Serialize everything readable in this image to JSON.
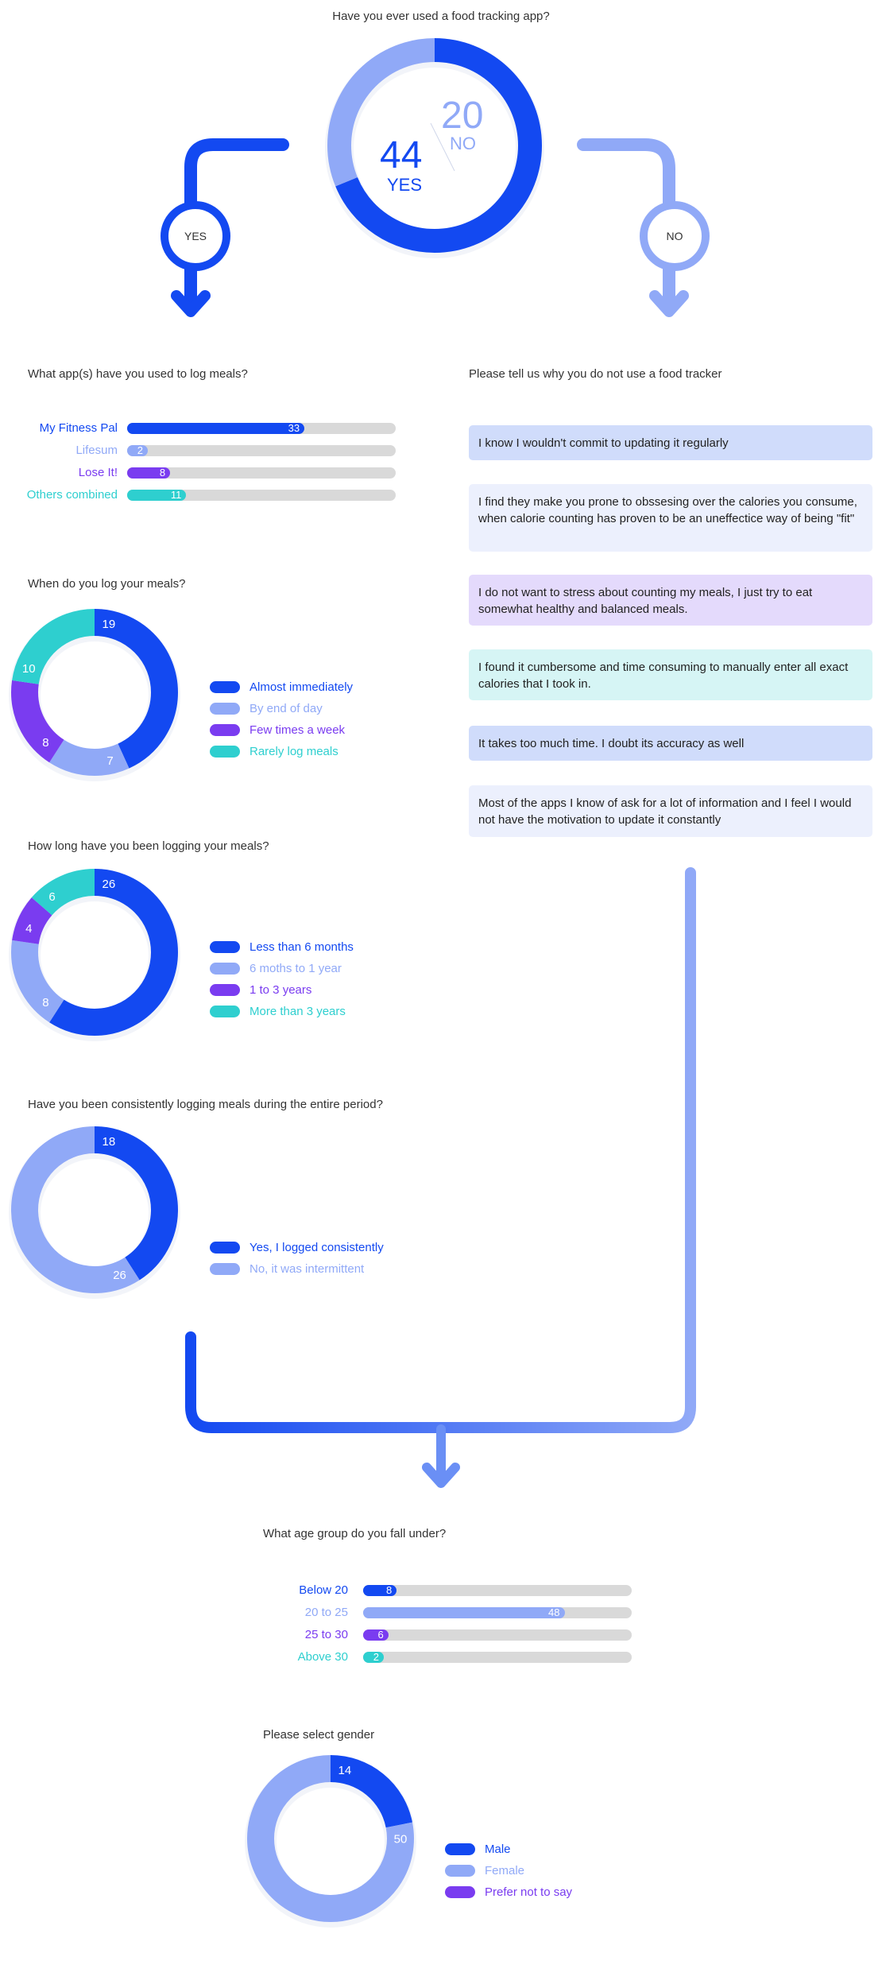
{
  "colors": {
    "blue": "#1349f1",
    "lightblue": "#90a9f7",
    "purple": "#7a3cf0",
    "teal": "#2ecfcf",
    "track": "#d9d9d9"
  },
  "intro": {
    "question": "Have you ever used a food tracking  app?",
    "yes_value": "44",
    "yes_label": "YES",
    "no_value": "20",
    "no_label": "NO",
    "yes_node": "YES",
    "no_node": "NO"
  },
  "apps": {
    "question": "What app(s) have you used to log meals?"
  },
  "reasons": {
    "question": "Please tell us why you do not use a food tracker",
    "items": [
      "I know I wouldn't commit to updating it regularly",
      "I find they make you prone to obssesing over the calories you consume, when calorie counting has proven to be an uneffectice way of being \"fit\"",
      "I do not want to stress about counting my meals, I just try to eat somewhat healthy and balanced meals.",
      "I found it cumbersome and time consuming to manually enter all exact calories that I took in.",
      "It takes too much time. I doubt its accuracy as well",
      "Most of the apps I know of ask for a lot of information and I feel I would not have the motivation to update it constantly"
    ]
  },
  "when": {
    "question": "When do you log your meals?"
  },
  "howlong": {
    "question": "How long have you been logging your meals?"
  },
  "consistent": {
    "question": "Have you been consistently logging meals during the entire period?"
  },
  "age": {
    "question": "What age group do you fall under?"
  },
  "gender": {
    "question": "Please select gender"
  },
  "chart_data": [
    {
      "id": "used_app",
      "type": "pie",
      "title": "Have you ever used a food tracking  app?",
      "categories": [
        "YES",
        "NO"
      ],
      "values": [
        44,
        20
      ],
      "colors": [
        "#1349f1",
        "#90a9f7"
      ]
    },
    {
      "id": "apps_used",
      "type": "bar",
      "title": "What app(s) have you used to log meals?",
      "categories": [
        "My Fitness Pal",
        "Lifesum",
        "Lose It!",
        "Others combined"
      ],
      "values": [
        33,
        2,
        8,
        11
      ],
      "max": 50,
      "colors": [
        "#1349f1",
        "#90a9f7",
        "#7a3cf0",
        "#2ecfcf"
      ]
    },
    {
      "id": "when_log",
      "type": "pie",
      "title": "When do you log your meals?",
      "categories": [
        "Almost immediately",
        "By end of day",
        "Few times a week",
        "Rarely log meals"
      ],
      "values": [
        19,
        7,
        8,
        10
      ],
      "colors": [
        "#1349f1",
        "#90a9f7",
        "#7a3cf0",
        "#2ecfcf"
      ]
    },
    {
      "id": "how_long",
      "type": "pie",
      "title": "How long have you been logging your meals?",
      "categories": [
        "Less than 6 months",
        "6 moths to 1 year",
        "1 to 3 years",
        "More than 3 years"
      ],
      "values": [
        26,
        8,
        4,
        6
      ],
      "colors": [
        "#1349f1",
        "#90a9f7",
        "#7a3cf0",
        "#2ecfcf"
      ]
    },
    {
      "id": "consistent",
      "type": "pie",
      "title": "Have you been consistently logging meals during the entire period?",
      "categories": [
        "Yes, I logged consistently",
        "No, it was intermittent"
      ],
      "values": [
        18,
        26
      ],
      "colors": [
        "#1349f1",
        "#90a9f7"
      ]
    },
    {
      "id": "age_group",
      "type": "bar",
      "title": "What age group do you fall under?",
      "categories": [
        "Below 20",
        "20 to 25",
        "25 to 30",
        "Above 30"
      ],
      "values": [
        8,
        48,
        6,
        2
      ],
      "max": 64,
      "colors": [
        "#1349f1",
        "#90a9f7",
        "#7a3cf0",
        "#2ecfcf"
      ]
    },
    {
      "id": "gender",
      "type": "pie",
      "title": "Please select gender",
      "categories": [
        "Male",
        "Female",
        "Prefer not to say"
      ],
      "values": [
        14,
        50,
        0
      ],
      "colors": [
        "#1349f1",
        "#90a9f7",
        "#7a3cf0"
      ]
    }
  ]
}
